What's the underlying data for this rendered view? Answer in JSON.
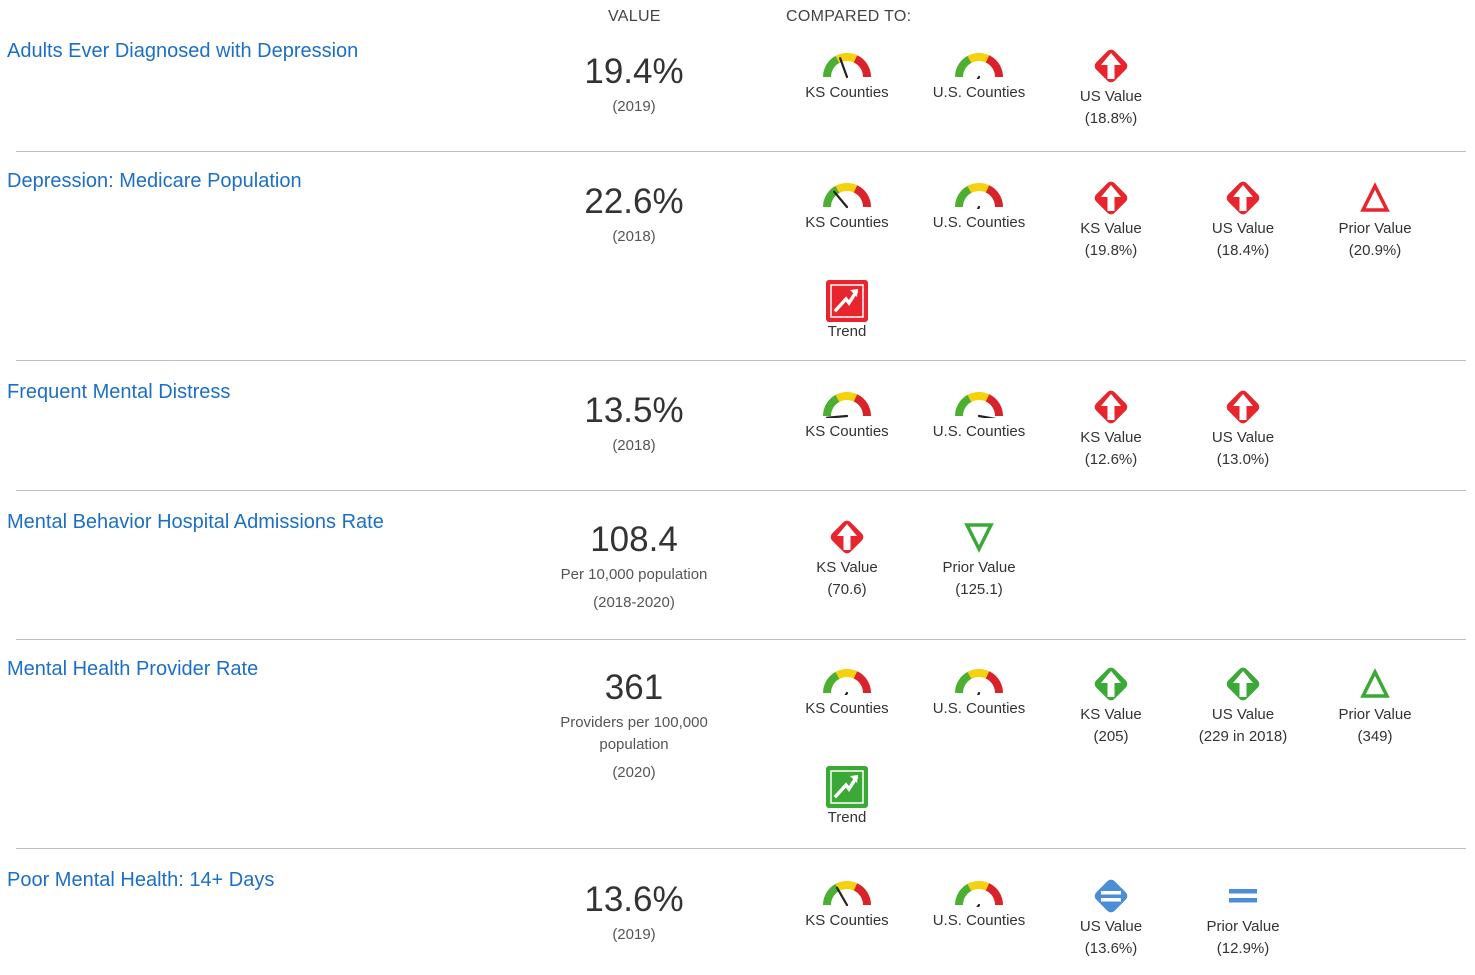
{
  "header": {
    "value_label": "VALUE",
    "compared_label": "COMPARED TO:"
  },
  "colors": {
    "link": "#1c6fc7",
    "red": "#e8242c",
    "green": "#3aa935",
    "blue": "#4a8ed8",
    "gauge_green": "#4caf32",
    "gauge_yellow": "#f5d10e",
    "gauge_red": "#d8232a"
  },
  "indicators": [
    {
      "title": "Adults Ever Diagnosed with Depression",
      "value": "19.4%",
      "unit": "",
      "year": "(2019)",
      "comparisons": [
        {
          "icon": "gauge-icon",
          "label": "KS Counties",
          "sub": ""
        },
        {
          "icon": "gauge-icon",
          "label": "U.S. Counties",
          "sub": ""
        },
        {
          "icon": "red-diamond-up-arrow-icon",
          "label": "US Value",
          "sub": "(18.8%)"
        }
      ]
    },
    {
      "title": "Depression: Medicare Population",
      "value": "22.6%",
      "unit": "",
      "year": "(2018)",
      "comparisons": [
        {
          "icon": "gauge-icon",
          "label": "KS Counties",
          "sub": ""
        },
        {
          "icon": "gauge-icon",
          "label": "U.S. Counties",
          "sub": ""
        },
        {
          "icon": "red-diamond-up-arrow-icon",
          "label": "KS Value",
          "sub": "(19.8%)"
        },
        {
          "icon": "red-diamond-up-arrow-icon",
          "label": "US Value",
          "sub": "(18.4%)"
        },
        {
          "icon": "red-triangle-up-icon",
          "label": "Prior Value",
          "sub": "(20.9%)"
        },
        {
          "icon": "red-trend-up-icon",
          "label": "Trend",
          "sub": ""
        }
      ]
    },
    {
      "title": "Frequent Mental Distress",
      "value": "13.5%",
      "unit": "",
      "year": "(2018)",
      "comparisons": [
        {
          "icon": "gauge-icon",
          "label": "KS Counties",
          "sub": ""
        },
        {
          "icon": "gauge-icon",
          "label": "U.S. Counties",
          "sub": ""
        },
        {
          "icon": "red-diamond-up-arrow-icon",
          "label": "KS Value",
          "sub": "(12.6%)"
        },
        {
          "icon": "red-diamond-up-arrow-icon",
          "label": "US Value",
          "sub": "(13.0%)"
        }
      ]
    },
    {
      "title": "Mental Behavior Hospital Admissions Rate",
      "value": "108.4",
      "unit": "Per 10,000 population",
      "year": "(2018-2020)",
      "comparisons": [
        {
          "icon": "red-diamond-up-arrow-icon",
          "label": "KS Value",
          "sub": "(70.6)"
        },
        {
          "icon": "green-triangle-down-icon",
          "label": "Prior Value",
          "sub": "(125.1)"
        }
      ]
    },
    {
      "title": "Mental Health Provider Rate",
      "value": "361",
      "unit": "Providers per 100,000 population",
      "year": "(2020)",
      "comparisons": [
        {
          "icon": "gauge-icon",
          "label": "KS Counties",
          "sub": ""
        },
        {
          "icon": "gauge-icon",
          "label": "U.S. Counties",
          "sub": ""
        },
        {
          "icon": "green-diamond-up-arrow-icon",
          "label": "KS Value",
          "sub": "(205)"
        },
        {
          "icon": "green-diamond-up-arrow-icon",
          "label": "US Value",
          "sub": "(229 in 2018)"
        },
        {
          "icon": "green-triangle-up-icon",
          "label": "Prior Value",
          "sub": "(349)"
        },
        {
          "icon": "green-trend-up-icon",
          "label": "Trend",
          "sub": ""
        }
      ]
    },
    {
      "title": "Poor Mental Health: 14+ Days",
      "value": "13.6%",
      "unit": "",
      "year": "(2019)",
      "comparisons": [
        {
          "icon": "gauge-icon",
          "label": "KS Counties",
          "sub": ""
        },
        {
          "icon": "gauge-icon",
          "label": "U.S. Counties",
          "sub": ""
        },
        {
          "icon": "blue-diamond-equal-icon",
          "label": "US Value",
          "sub": "(13.6%)"
        },
        {
          "icon": "blue-equal-icon",
          "label": "Prior Value",
          "sub": "(12.9%)"
        }
      ]
    }
  ]
}
